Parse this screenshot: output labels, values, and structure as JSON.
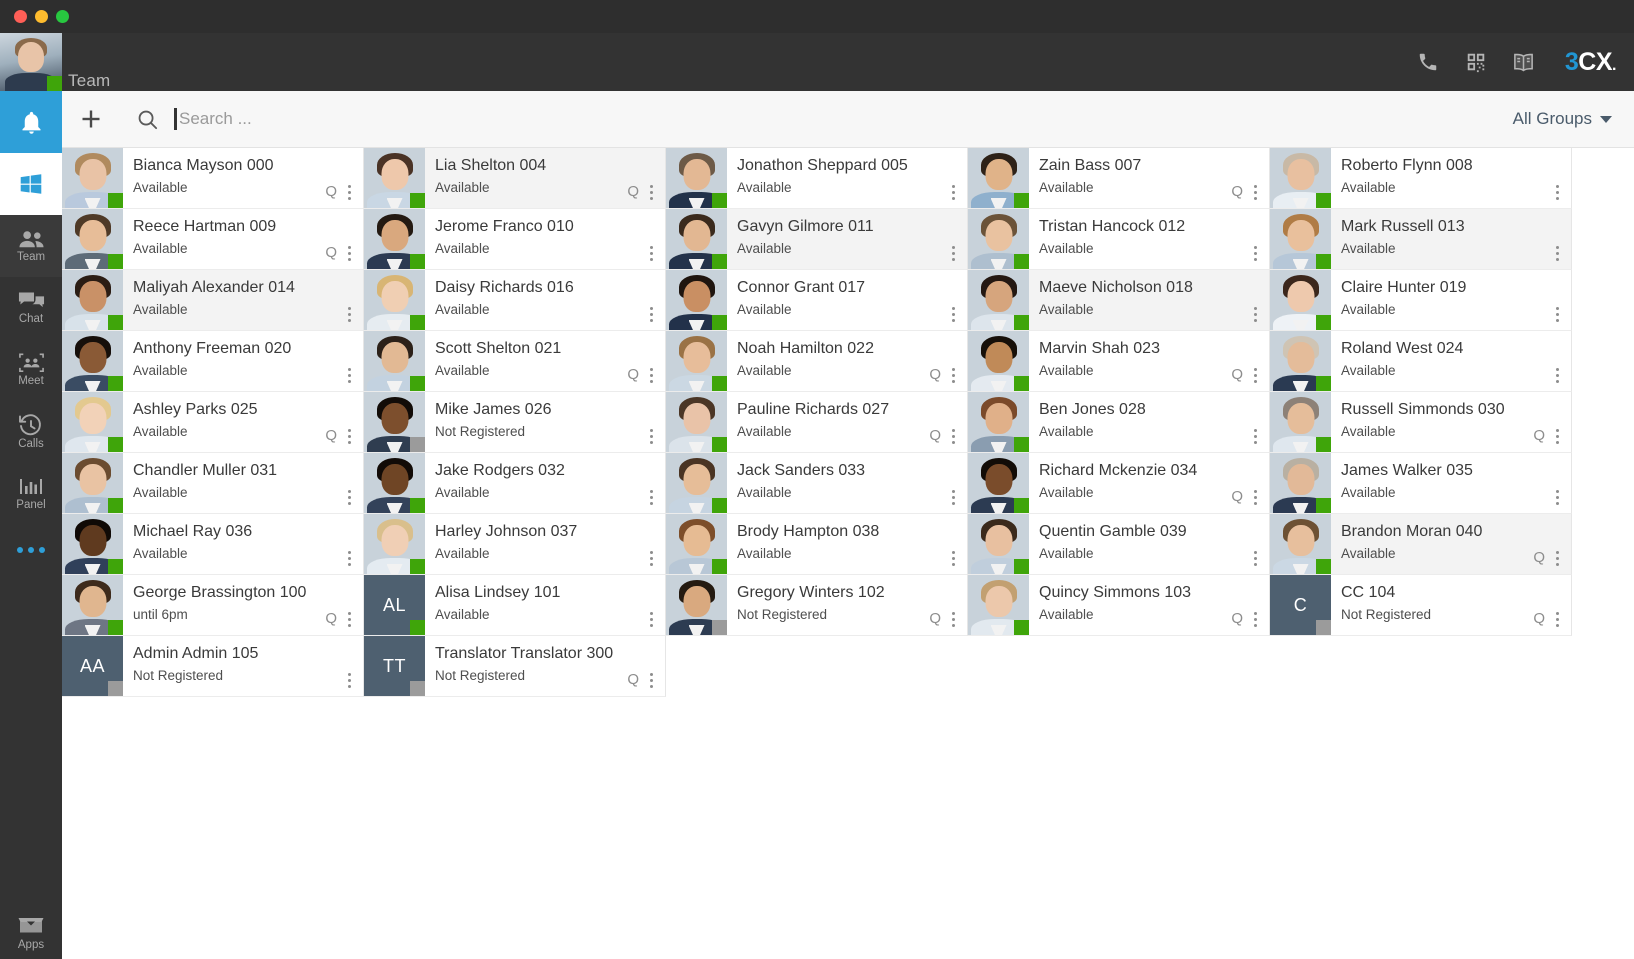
{
  "window": {
    "traffic_lights": [
      "close",
      "minimize",
      "maximize"
    ],
    "title": "Team"
  },
  "header": {
    "title": "Team",
    "my_presence": "available",
    "icons": [
      "phone-icon",
      "qr-code-icon",
      "phonebook-icon"
    ],
    "logo": {
      "part1": "3",
      "part2": "C",
      "part3": "X",
      "dot": "."
    }
  },
  "sidebar": {
    "items": [
      {
        "id": "notifications",
        "icon": "bell-icon",
        "label": "",
        "state": "highlight"
      },
      {
        "id": "windows",
        "icon": "windows-icon",
        "label": "",
        "state": "white"
      },
      {
        "id": "team",
        "icon": "people-icon",
        "label": "Team",
        "state": "active"
      },
      {
        "id": "chat",
        "icon": "chat-bubbles-icon",
        "label": "Chat",
        "state": "normal"
      },
      {
        "id": "meet",
        "icon": "meet-icon",
        "label": "Meet",
        "state": "normal"
      },
      {
        "id": "calls",
        "icon": "call-history-icon",
        "label": "Calls",
        "state": "normal"
      },
      {
        "id": "panel",
        "icon": "bar-chart-icon",
        "label": "Panel",
        "state": "normal"
      },
      {
        "id": "more",
        "icon": "ellipsis-icon",
        "label": "",
        "state": "normal"
      }
    ],
    "apps": {
      "icon": "apps-box-icon",
      "label": "Apps"
    }
  },
  "toolbar": {
    "add_icon": "plus-icon",
    "search_icon": "search-icon",
    "search_value": "",
    "search_placeholder": "Search ...",
    "groups_label": "All Groups",
    "groups_caret": "chevron-down-icon"
  },
  "colors": {
    "accent_blue": "#2e9fd8",
    "presence_available": "#3fa50a",
    "presence_offline": "#9b9b9b",
    "rail_bg": "#333333",
    "toolbar_bg": "#f7f7f7",
    "initials_avatar_bg": "#4e6070"
  },
  "contacts": [
    {
      "name": "Bianca Mayson 000",
      "status": "Available",
      "presence": "available",
      "avatar": "photo",
      "skin": "#e9c3a6",
      "hair": "#b08a5e",
      "torso": "#b9c9dd",
      "queue": true,
      "selected": false
    },
    {
      "name": "Lia Shelton 004",
      "status": "Available",
      "presence": "available",
      "avatar": "photo",
      "skin": "#eec8ab",
      "hair": "#4a3326",
      "torso": "#c9d7e4",
      "queue": true,
      "selected": true
    },
    {
      "name": "Jonathon Sheppard 005",
      "status": "Available",
      "presence": "available",
      "avatar": "photo",
      "skin": "#e3b894",
      "hair": "#6d5a47",
      "torso": "#22324a",
      "queue": false,
      "selected": false
    },
    {
      "name": "Zain Bass 007",
      "status": "Available",
      "presence": "available",
      "avatar": "photo",
      "skin": "#e0b389",
      "hair": "#2e2218",
      "torso": "#8fb0cd",
      "queue": true,
      "selected": false
    },
    {
      "name": "Roberto Flynn 008",
      "status": "Available",
      "presence": "available",
      "avatar": "photo",
      "skin": "#e8c0a0",
      "hair": "#c8b9a6",
      "torso": "#e8eef3",
      "queue": false,
      "selected": false
    },
    {
      "name": "Reece Hartman 009",
      "status": "Available",
      "presence": "available",
      "avatar": "photo",
      "skin": "#e7bd98",
      "hair": "#4f3a27",
      "torso": "#5d6b78",
      "queue": true,
      "selected": false
    },
    {
      "name": "Jerome Franco 010",
      "status": "Available",
      "presence": "available",
      "avatar": "photo",
      "skin": "#d9a87e",
      "hair": "#241a12",
      "torso": "#2b3a52",
      "queue": false,
      "selected": false
    },
    {
      "name": "Gavyn Gilmore 011",
      "status": "Available",
      "presence": "available",
      "avatar": "photo",
      "skin": "#e2b792",
      "hair": "#3a2a1d",
      "torso": "#23324a",
      "queue": false,
      "selected": true
    },
    {
      "name": "Tristan Hancock 012",
      "status": "Available",
      "presence": "available",
      "avatar": "photo",
      "skin": "#e9c2a0",
      "hair": "#6b5339",
      "torso": "#aebfcf",
      "queue": false,
      "selected": false
    },
    {
      "name": "Mark Russell 013",
      "status": "Available",
      "presence": "available",
      "avatar": "photo",
      "skin": "#e9c09c",
      "hair": "#b07c45",
      "torso": "#b6c7d8",
      "queue": false,
      "selected": true
    },
    {
      "name": "Maliyah Alexander 014",
      "status": "Available",
      "presence": "available",
      "avatar": "photo",
      "skin": "#c99167",
      "hair": "#2b1d14",
      "torso": "#d8e2ea",
      "queue": false,
      "selected": true
    },
    {
      "name": "Daisy Richards 016",
      "status": "Available",
      "presence": "available",
      "avatar": "photo",
      "skin": "#f0cfb3",
      "hair": "#d8b574",
      "torso": "#e6ecf1",
      "queue": false,
      "selected": false
    },
    {
      "name": "Connor Grant 017",
      "status": "Available",
      "presence": "available",
      "avatar": "photo",
      "skin": "#c98f63",
      "hair": "#1f150f",
      "torso": "#22314a",
      "queue": false,
      "selected": false
    },
    {
      "name": "Maeve Nicholson 018",
      "status": "Available",
      "presence": "available",
      "avatar": "photo",
      "skin": "#d6a57d",
      "hair": "#241812",
      "torso": "#dde5ec",
      "queue": false,
      "selected": true
    },
    {
      "name": "Claire Hunter 019",
      "status": "Available",
      "presence": "available",
      "avatar": "photo",
      "skin": "#eec9ad",
      "hair": "#3b271c",
      "torso": "#eef2f6",
      "queue": false,
      "selected": false
    },
    {
      "name": "Anthony Freeman 020",
      "status": "Available",
      "presence": "available",
      "avatar": "photo",
      "skin": "#8a5a36",
      "hair": "#160f0a",
      "torso": "#3a4c63",
      "queue": false,
      "selected": false
    },
    {
      "name": "Scott Shelton 021",
      "status": "Available",
      "presence": "available",
      "avatar": "photo",
      "skin": "#e2b994",
      "hair": "#2c2119",
      "torso": "#c3d2e0",
      "queue": true,
      "selected": false
    },
    {
      "name": "Noah Hamilton 022",
      "status": "Available",
      "presence": "available",
      "avatar": "photo",
      "skin": "#e7bd9a",
      "hair": "#9a7245",
      "torso": "#cbd8e3",
      "queue": true,
      "selected": false
    },
    {
      "name": "Marvin Shah 023",
      "status": "Available",
      "presence": "available",
      "avatar": "photo",
      "skin": "#c08a58",
      "hair": "#171009",
      "torso": "#e4eaf0",
      "queue": true,
      "selected": false
    },
    {
      "name": "Roland West 024",
      "status": "Available",
      "presence": "available",
      "avatar": "photo",
      "skin": "#e4bc9a",
      "hair": "#cfc4b4",
      "torso": "#2a3a52",
      "queue": false,
      "selected": false
    },
    {
      "name": "Ashley Parks 025",
      "status": "Available",
      "presence": "available",
      "avatar": "photo",
      "skin": "#f2d2b8",
      "hair": "#e3c98f",
      "torso": "#dfe7ee",
      "queue": true,
      "selected": false
    },
    {
      "name": "Mike James 026",
      "status": "Not Registered",
      "presence": "offline",
      "avatar": "photo",
      "skin": "#7d4f2d",
      "hair": "#120c08",
      "torso": "#2f3d50",
      "queue": false,
      "selected": false
    },
    {
      "name": "Pauline Richards 027",
      "status": "Available",
      "presence": "available",
      "avatar": "photo",
      "skin": "#e9c3a8",
      "hair": "#4b3626",
      "torso": "#dbe3ea",
      "queue": true,
      "selected": false
    },
    {
      "name": "Ben Jones 028",
      "status": "Available",
      "presence": "available",
      "avatar": "photo",
      "skin": "#e0b089",
      "hair": "#7b4a2a",
      "torso": "#8a9db0",
      "queue": false,
      "selected": false
    },
    {
      "name": "Russell Simmonds 030",
      "status": "Available",
      "presence": "available",
      "avatar": "photo",
      "skin": "#e5bd9a",
      "hair": "#8d8177",
      "torso": "#dfe7ee",
      "queue": true,
      "selected": false
    },
    {
      "name": "Chandler Muller 031",
      "status": "Available",
      "presence": "available",
      "avatar": "photo",
      "skin": "#e9c3a3",
      "hair": "#6b4c30",
      "torso": "#aebfd0",
      "queue": false,
      "selected": false
    },
    {
      "name": "Jake Rodgers 032",
      "status": "Available",
      "presence": "available",
      "avatar": "photo",
      "skin": "#6f4525",
      "hair": "#120b07",
      "torso": "#33425a",
      "queue": false,
      "selected": false
    },
    {
      "name": "Jack Sanders 033",
      "status": "Available",
      "presence": "available",
      "avatar": "photo",
      "skin": "#e6bd98",
      "hair": "#4a3423",
      "torso": "#c6d4e1",
      "queue": false,
      "selected": false
    },
    {
      "name": "Richard Mckenzie 034",
      "status": "Available",
      "presence": "available",
      "avatar": "photo",
      "skin": "#7a4c2b",
      "hair": "#120c07",
      "torso": "#2c3b52",
      "queue": true,
      "selected": false
    },
    {
      "name": "James Walker 035",
      "status": "Available",
      "presence": "available",
      "avatar": "photo",
      "skin": "#e2b998",
      "hair": "#b9b0a2",
      "torso": "#2b3a52",
      "queue": false,
      "selected": false
    },
    {
      "name": "Michael Ray 036",
      "status": "Available",
      "presence": "available",
      "avatar": "photo",
      "skin": "#5f3a1f",
      "hair": "#100a06",
      "torso": "#30405a",
      "queue": false,
      "selected": false
    },
    {
      "name": "Harley Johnson 037",
      "status": "Available",
      "presence": "available",
      "avatar": "photo",
      "skin": "#f0cfb5",
      "hair": "#d9bf8c",
      "torso": "#e4ebf1",
      "queue": false,
      "selected": false
    },
    {
      "name": "Brody Hampton 038",
      "status": "Available",
      "presence": "available",
      "avatar": "photo",
      "skin": "#e6bb93",
      "hair": "#7d4e2a",
      "torso": "#b8c7d6",
      "queue": false,
      "selected": false
    },
    {
      "name": "Quentin Gamble 039",
      "status": "Available",
      "presence": "available",
      "avatar": "photo",
      "skin": "#e8c0a0",
      "hair": "#3b2a1c",
      "torso": "#c0cedc",
      "queue": false,
      "selected": false
    },
    {
      "name": "Brandon Moran 040",
      "status": "Available",
      "presence": "available",
      "avatar": "photo",
      "skin": "#e7bf9d",
      "hair": "#6d5134",
      "torso": "#cbd8e4",
      "queue": true,
      "selected": true
    },
    {
      "name": "George Brassington 100",
      "status": "until 6pm",
      "presence": "available",
      "avatar": "photo",
      "skin": "#e0b68f",
      "hair": "#3e2b1c",
      "torso": "#6e7684",
      "queue": true,
      "selected": false
    },
    {
      "name": "Alisa Lindsey 101",
      "status": "Available",
      "presence": "available",
      "avatar": "initials",
      "initials": "AL",
      "queue": false,
      "selected": false
    },
    {
      "name": "Gregory Winters 102",
      "status": "Not Registered",
      "presence": "offline",
      "avatar": "photo",
      "skin": "#d9a97f",
      "hair": "#241a11",
      "torso": "#2d3c52",
      "queue": true,
      "selected": false
    },
    {
      "name": "Quincy Simmons 103",
      "status": "Available",
      "presence": "available",
      "avatar": "photo",
      "skin": "#ecc8ab",
      "hair": "#c2a071",
      "torso": "#e2e9ef",
      "queue": true,
      "selected": false
    },
    {
      "name": "CC 104",
      "status": "Not Registered",
      "presence": "offline",
      "avatar": "initials",
      "initials": "C",
      "queue": true,
      "selected": false
    },
    {
      "name": "Admin Admin 105",
      "status": "Not Registered",
      "presence": "offline",
      "avatar": "initials",
      "initials": "AA",
      "queue": false,
      "selected": false
    },
    {
      "name": "Translator Translator 300",
      "status": "Not Registered",
      "presence": "offline",
      "avatar": "initials",
      "initials": "TT",
      "queue": true,
      "selected": false
    }
  ]
}
